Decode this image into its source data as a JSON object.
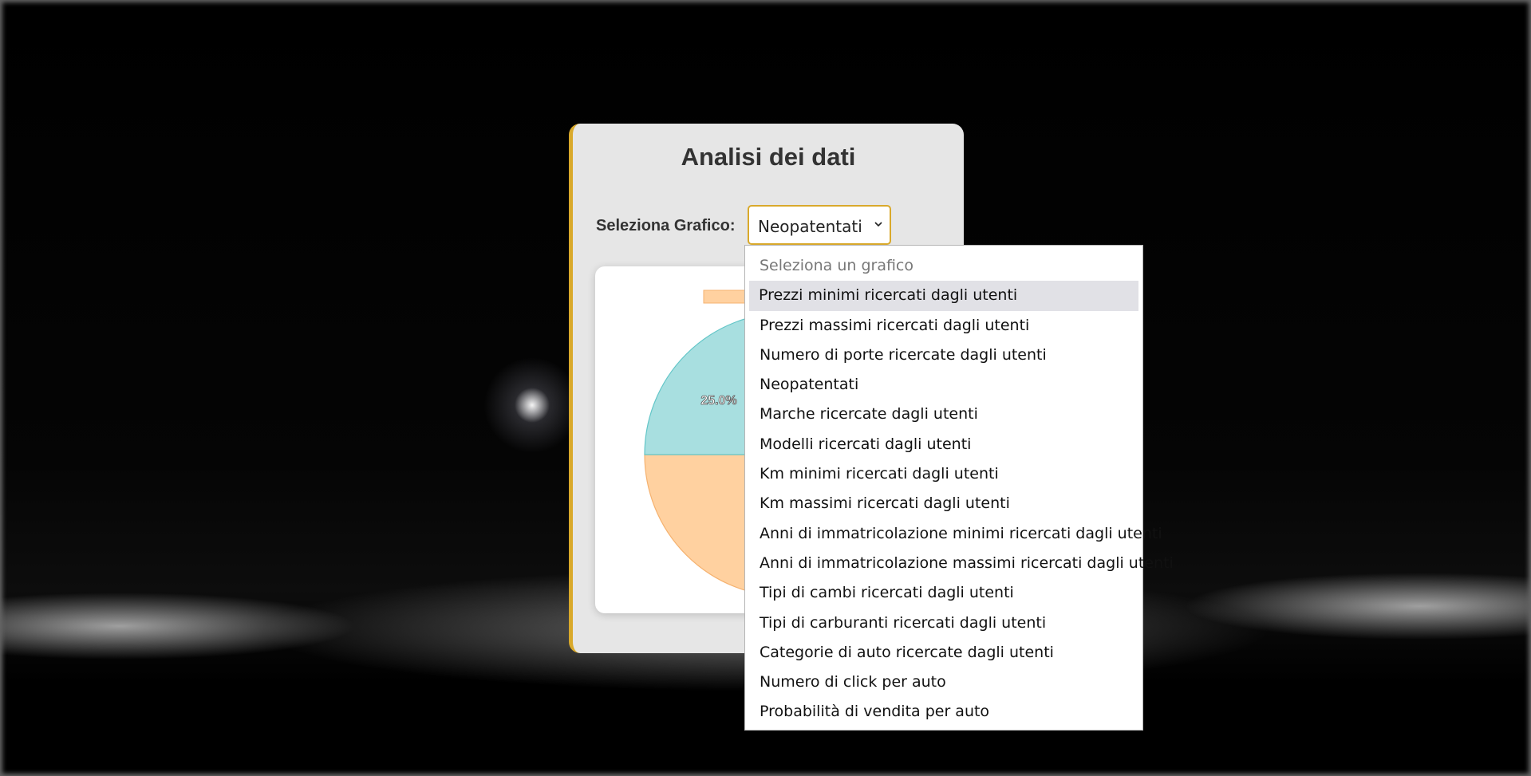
{
  "page": {
    "title": "Analisi dei dati",
    "accent_color": "#d9a92b"
  },
  "selector": {
    "label": "Seleziona Grafico:",
    "selected": "Neopatentati",
    "expanded": true,
    "options": [
      {
        "label": "Seleziona un grafico",
        "placeholder": true
      },
      {
        "label": "Prezzi minimi ricercati dagli utenti",
        "highlighted": true
      },
      {
        "label": "Prezzi massimi ricercati dagli utenti"
      },
      {
        "label": "Numero di porte ricercate dagli utenti"
      },
      {
        "label": "Neopatentati"
      },
      {
        "label": "Marche ricercate dagli utenti"
      },
      {
        "label": "Modelli ricercati dagli utenti"
      },
      {
        "label": "Km minimi ricercati dagli utenti"
      },
      {
        "label": "Km massimi ricercati dagli utenti"
      },
      {
        "label": "Anni di immatricolazione minimi ricercati dagli utenti"
      },
      {
        "label": "Anni di immatricolazione massimi ricercati dagli utenti"
      },
      {
        "label": "Tipi di cambi ricercati dagli utenti"
      },
      {
        "label": "Tipi di carburanti ricercati dagli utenti"
      },
      {
        "label": "Categorie di auto ricercate dagli utenti"
      },
      {
        "label": "Numero di click per auto"
      },
      {
        "label": "Probabilità di vendita per auto"
      }
    ]
  },
  "chart_data": {
    "type": "pie",
    "slices": [
      {
        "value": 25.0,
        "label": "25.0%",
        "color": "#a8dfe0"
      },
      {
        "value": 50.0,
        "label": "",
        "color": "#ffd1a0"
      }
    ],
    "legend_colors": [
      "#ffd1a0"
    ],
    "partially_hidden": true
  }
}
